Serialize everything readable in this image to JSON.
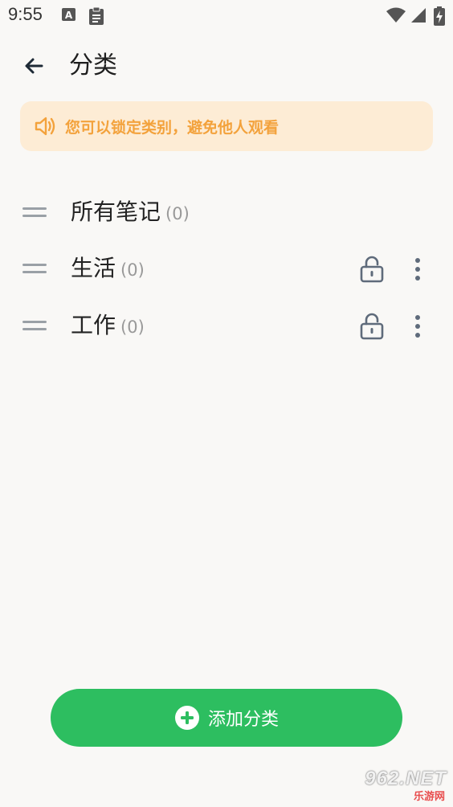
{
  "status_bar": {
    "time": "9:55",
    "left_icons": [
      "a-notification-icon",
      "clipboard-icon"
    ],
    "right_icons": [
      "wifi-icon",
      "signal-icon",
      "battery-charging-icon"
    ]
  },
  "header": {
    "back_icon": "arrow-left-icon",
    "title": "分类"
  },
  "notice": {
    "icon": "speaker-icon",
    "text": "您可以锁定类别，避免他人观看",
    "color": "#f3a23c",
    "background": "#fdecd5"
  },
  "categories": [
    {
      "name": "所有笔记",
      "count": "(0)",
      "lockable": false
    },
    {
      "name": "生活",
      "count": "(0)",
      "lockable": true
    },
    {
      "name": "工作",
      "count": "(0)",
      "lockable": true
    }
  ],
  "add_button": {
    "icon": "plus-circle-icon",
    "label": "添加分类",
    "color": "#2dbe60"
  },
  "watermark": {
    "logo": "962.NET",
    "sub": "乐游网"
  }
}
